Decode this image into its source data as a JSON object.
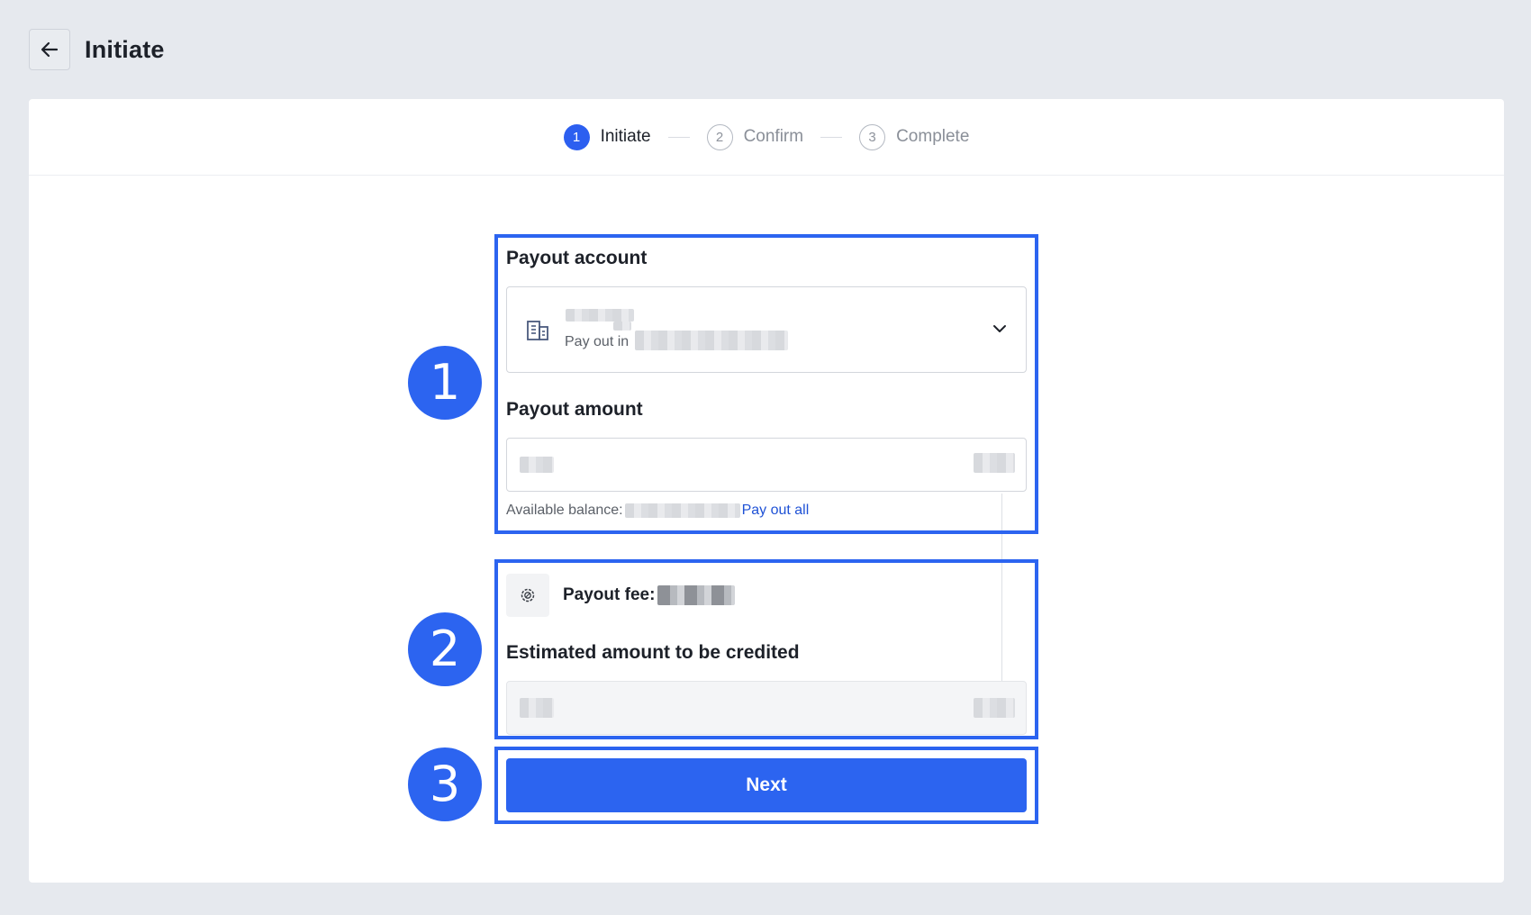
{
  "header": {
    "back_icon": "arrow-left-icon",
    "title": "Initiate"
  },
  "steps": [
    {
      "number": "1",
      "label": "Initiate",
      "state": "active"
    },
    {
      "number": "2",
      "label": "Confirm",
      "state": "inactive"
    },
    {
      "number": "3",
      "label": "Complete",
      "state": "inactive"
    }
  ],
  "form": {
    "payout_account_label": "Payout account",
    "account_icon": "bank-building-icon",
    "account_subtext_prefix": "Pay out in",
    "payout_amount_label": "Payout amount",
    "available_balance_label": "Available balance:",
    "pay_out_all_label": "Pay out all",
    "fee_icon": "settings-badge-icon",
    "payout_fee_label": "Payout fee:",
    "estimated_label": "Estimated amount to be credited",
    "next_label": "Next"
  },
  "annotations": {
    "badges": [
      "1",
      "2",
      "3"
    ],
    "highlight_color": "#2c64f0"
  },
  "colors": {
    "accent": "#2c64f0",
    "background": "#e6e9ee",
    "card": "#ffffff",
    "link": "#1f52d6"
  }
}
